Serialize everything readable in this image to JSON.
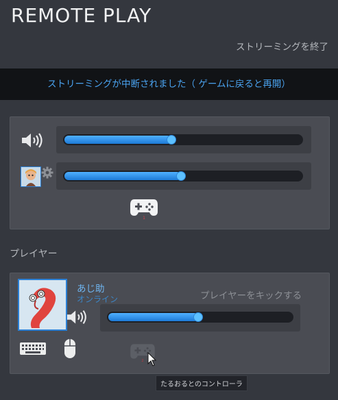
{
  "header": {
    "title": "REMOTE PLAY",
    "end_streaming_label": "ストリーミングを終了"
  },
  "banner": {
    "message": "ストリーミングが中断されました（ ゲームに戻ると再開）"
  },
  "audio_controls": {
    "speaker_volume": 0.45,
    "user_volume": 0.49,
    "icons": [
      "speaker-icon",
      "user-avatar",
      "gear-icon",
      "gamepad-icon"
    ]
  },
  "players": {
    "heading": "プレイヤー",
    "list": [
      {
        "name": "あじ助",
        "status": "オンライン",
        "kick_label": "プレイヤーをキックする",
        "volume": 0.49,
        "icons": [
          "speaker-icon",
          "keyboard-icon",
          "mouse-icon",
          "gamepad-icon"
        ],
        "controller_tooltip": "たるおるとのコントローラ"
      }
    ]
  },
  "colors": {
    "accent": "#1d7ad6",
    "banner_text": "#4aa3f0",
    "background": "#34373e"
  }
}
